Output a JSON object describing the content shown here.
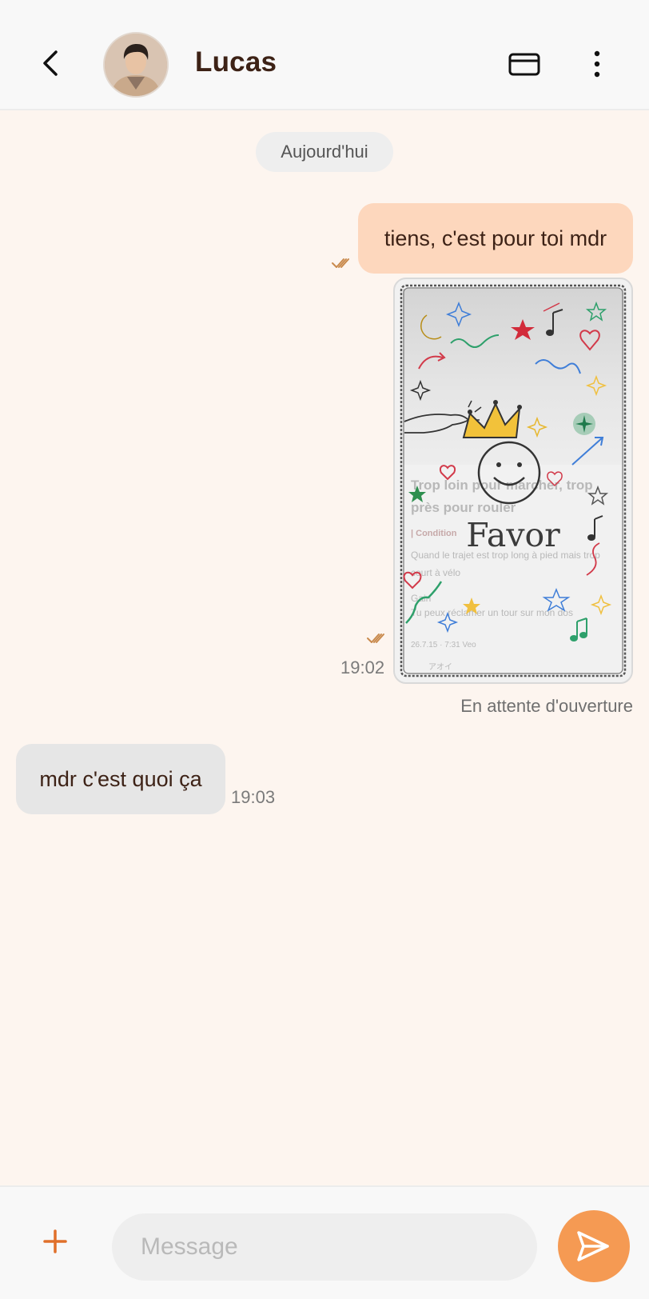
{
  "header": {
    "contact_name": "Lucas",
    "back_icon": "chevron-left-icon",
    "card_icon": "card-icon",
    "more_icon": "more-vertical-icon"
  },
  "conversation": {
    "date_separator": "Aujourd'hui",
    "messages": [
      {
        "direction": "outgoing",
        "type": "text",
        "text": "tiens, c'est pour toi mdr",
        "status": "read"
      },
      {
        "direction": "outgoing",
        "type": "favor-card",
        "time": "19:02",
        "status": "read",
        "status_text": "En attente d'ouverture",
        "card": {
          "overlay_title": "Favor",
          "faded_title": "Trop loin pour marcher, trop près pour rouler",
          "faded_condition_label": "| Condition",
          "faded_condition": "Quand le trajet est trop long à pied mais trop court à vélo",
          "faded_reward_label": "Gain",
          "faded_reward": "Tu peux réclamer un tour sur mon dos",
          "faded_footer": "26.7.15 · 7:31 Veo",
          "faded_author": "アオイ"
        }
      },
      {
        "direction": "incoming",
        "type": "text",
        "text": "mdr c'est quoi ça",
        "time": "19:03"
      }
    ]
  },
  "composer": {
    "placeholder": "Message",
    "add_icon": "plus-icon",
    "send_icon": "send-icon"
  },
  "colors": {
    "accent": "#f59a53",
    "outgoing_bubble": "#fdd7bd",
    "incoming_bubble": "#e6e6e6",
    "chat_background": "#fdf5ef",
    "name_text": "#3d2216"
  }
}
